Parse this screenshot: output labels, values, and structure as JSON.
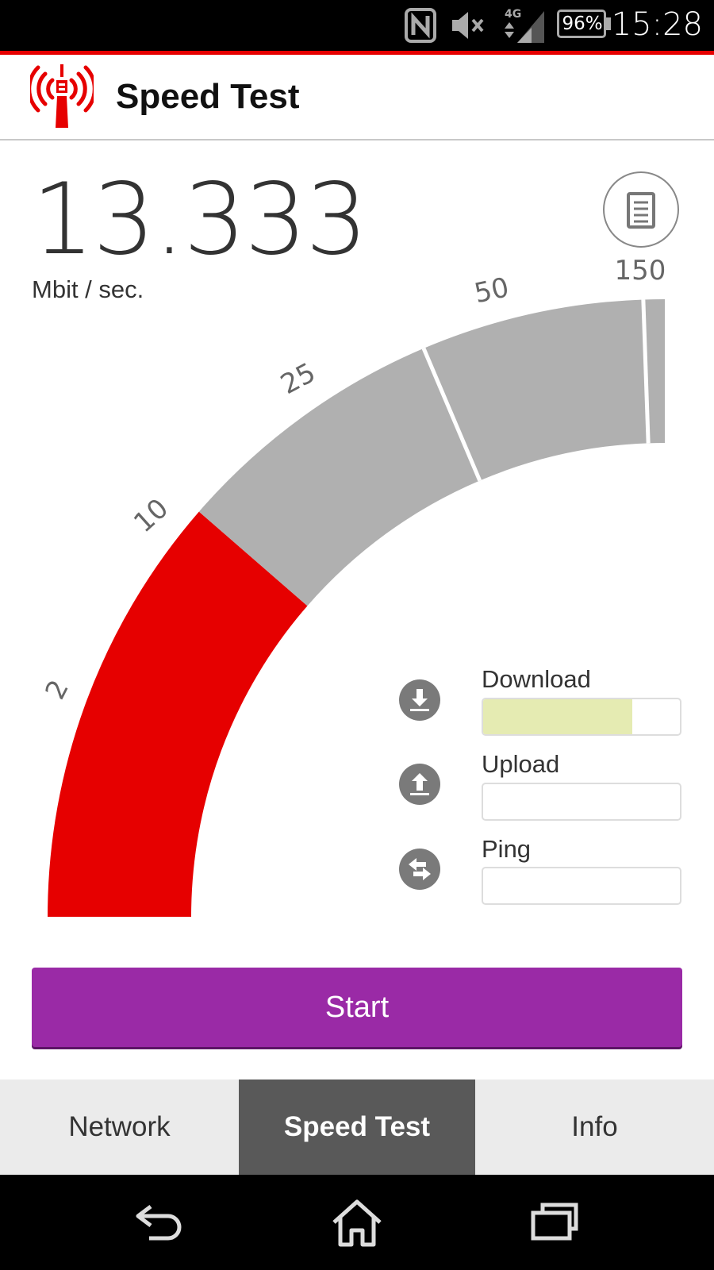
{
  "status_bar": {
    "time": "15:28",
    "battery": "96%",
    "network": "4G",
    "icons": [
      "nfc-icon",
      "mute-icon",
      "signal-icon",
      "battery-icon"
    ]
  },
  "app": {
    "title": "Speed Test",
    "logo_icon": "radio-tower-icon",
    "accent_color": "#e60000"
  },
  "speed": {
    "value": "13.333",
    "unit": "Mbit / sec.",
    "report_icon": "document-icon"
  },
  "gauge": {
    "tick_labels": [
      "2",
      "10",
      "25",
      "50",
      "150"
    ],
    "active_color": "#e60000",
    "inactive_color": "#b0b0b0",
    "active_segments": 1
  },
  "metrics": {
    "download": {
      "label": "Download",
      "icon": "download-icon",
      "progress": 0.76
    },
    "upload": {
      "label": "Upload",
      "icon": "upload-icon",
      "progress": 0
    },
    "ping": {
      "label": "Ping",
      "icon": "swap-arrows-icon",
      "progress": 0
    }
  },
  "start_button": {
    "label": "Start",
    "color": "#9a2aa6"
  },
  "tabs": [
    {
      "label": "Network",
      "active": false
    },
    {
      "label": "Speed Test",
      "active": true
    },
    {
      "label": "Info",
      "active": false
    }
  ],
  "nav_bar": {
    "icons": [
      "back-icon",
      "home-icon",
      "recents-icon"
    ]
  }
}
